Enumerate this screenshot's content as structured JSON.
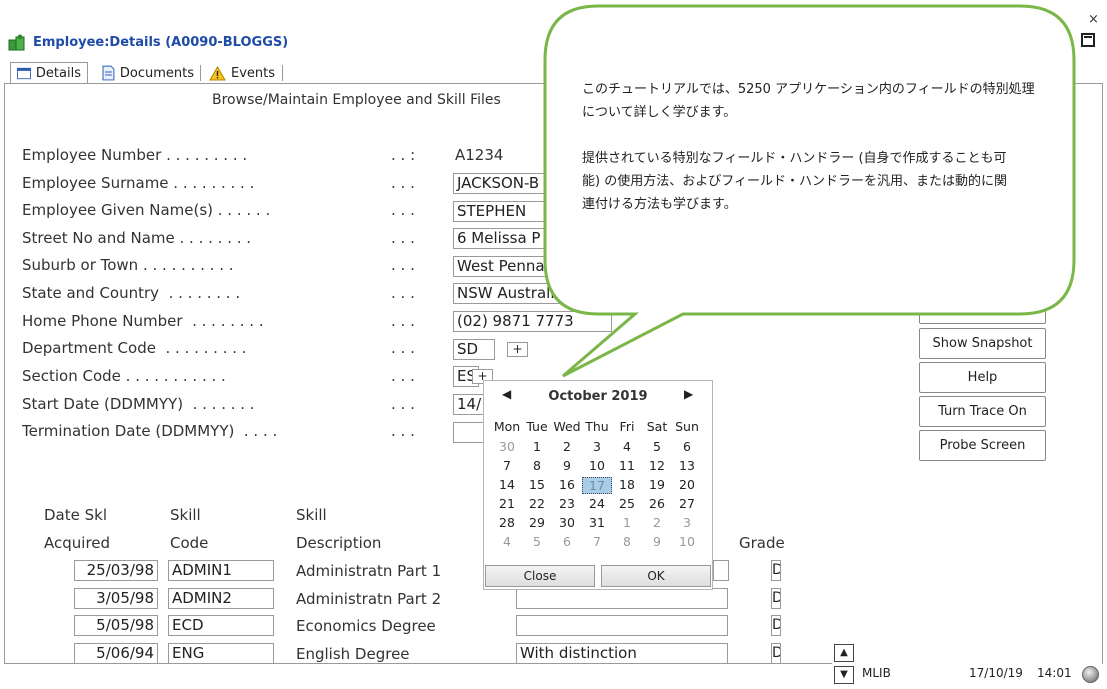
{
  "window": {
    "title": "Employee:Details (A0090-BLOGGS)",
    "close_glyph": "×"
  },
  "tabs": [
    {
      "label": "Details",
      "icon": "details-icon"
    },
    {
      "label": "Documents",
      "icon": "document-icon"
    },
    {
      "label": "Events",
      "icon": "warning-icon"
    }
  ],
  "screen_title": "Browse/Maintain Employee and Skill Files",
  "form": {
    "fields": [
      {
        "label": "Employee Number . . . . . . . . .",
        "dots": ". . :",
        "value": "A1234"
      },
      {
        "label": "Employee Surname . . . . . . . . .",
        "dots": ". . .",
        "value": "JACKSON-B"
      },
      {
        "label": "Employee Given Name(s) . . . . . .",
        "dots": ". . .",
        "value": "STEPHEN"
      },
      {
        "label": "Street No and Name . . . . . . . .",
        "dots": ". . .",
        "value": "6 Melissa P"
      },
      {
        "label": "Suburb or Town . . . . . . . . . .",
        "dots": ". . .",
        "value": "West Penna"
      },
      {
        "label": "State and Country  . . . . . . . .",
        "dots": ". . .",
        "value": "NSW Australia"
      },
      {
        "label": "Home Phone Number  . . . . . . . .",
        "dots": ". . .",
        "value": "(02) 9871 7773"
      },
      {
        "label": "Department Code  . . . . . . . . .",
        "dots": ". . .",
        "value": "SD"
      },
      {
        "label": "Section Code . . . . . . . . . . .",
        "dots": ". . .",
        "value": "ES"
      },
      {
        "label": "Start Date (DDMMYY)  . . . . . . .",
        "dots": ". . .",
        "value": "14/"
      },
      {
        "label": "Termination Date (DDMMYY)  . . . .",
        "dots": ". . .",
        "value": ""
      }
    ],
    "plus_label": "+"
  },
  "buttons": {
    "show_snapshot": "Show Snapshot",
    "help": "Help",
    "turn_trace_on": "Turn Trace On",
    "probe_screen": "Probe Screen"
  },
  "skills": {
    "headers": {
      "date_line1": "Date Skl",
      "date_line2": "Acquired",
      "skill_line1": "Skill",
      "skill_line2": "Code",
      "desc_line1": "Skill",
      "desc_line2": "Description",
      "grade": "Grade"
    },
    "rows": [
      {
        "date": "25/03/98",
        "code": "ADMIN1",
        "desc": "Administratn Part 1",
        "comment": "",
        "grade": "D"
      },
      {
        "date": "3/05/98",
        "code": "ADMIN2",
        "desc": "Administratn Part 2",
        "comment": "",
        "grade": "D"
      },
      {
        "date": "5/05/98",
        "code": "ECD",
        "desc": "Economics Degree",
        "comment": "",
        "grade": "D"
      },
      {
        "date": "5/06/94",
        "code": "ENG",
        "desc": "English Degree",
        "comment": "With distinction",
        "grade": "D"
      }
    ]
  },
  "calendar": {
    "month": "October 2019",
    "prev": "◀",
    "next": "▶",
    "dow": [
      "Mon",
      "Tue",
      "Wed",
      "Thu",
      "Fri",
      "Sat",
      "Sun"
    ],
    "weeks": [
      [
        "30",
        "1",
        "2",
        "3",
        "4",
        "5",
        "6"
      ],
      [
        "7",
        "8",
        "9",
        "10",
        "11",
        "12",
        "13"
      ],
      [
        "14",
        "15",
        "16",
        "17",
        "18",
        "19",
        "20"
      ],
      [
        "21",
        "22",
        "23",
        "24",
        "25",
        "26",
        "27"
      ],
      [
        "28",
        "29",
        "30",
        "31",
        "1",
        "2",
        "3"
      ],
      [
        "4",
        "5",
        "6",
        "7",
        "8",
        "9",
        "10"
      ]
    ],
    "other_month": [
      [
        0
      ],
      [],
      [],
      [],
      [
        4,
        5,
        6
      ],
      [
        0,
        1,
        2,
        3,
        4,
        5,
        6
      ]
    ],
    "selected": {
      "week": 2,
      "day": 3
    },
    "close_label": "Close",
    "ok_label": "OK"
  },
  "tooltip": {
    "line1": "このチュートリアルでは、5250 アプリケーション内のフィールドの特別処理",
    "line2": "について詳しく学びます。",
    "line3": "提供されている特別なフィールド・ハンドラー (自身で作成することも可",
    "line4": "能) の使用方法、およびフィールド・ハンドラーを汎用、または動的に関",
    "line5": "連付ける方法も学びます。",
    "border_color": "#7ab648"
  },
  "status_bar": {
    "library": "MLIB",
    "date": "17/10/19",
    "time": "14:01"
  }
}
